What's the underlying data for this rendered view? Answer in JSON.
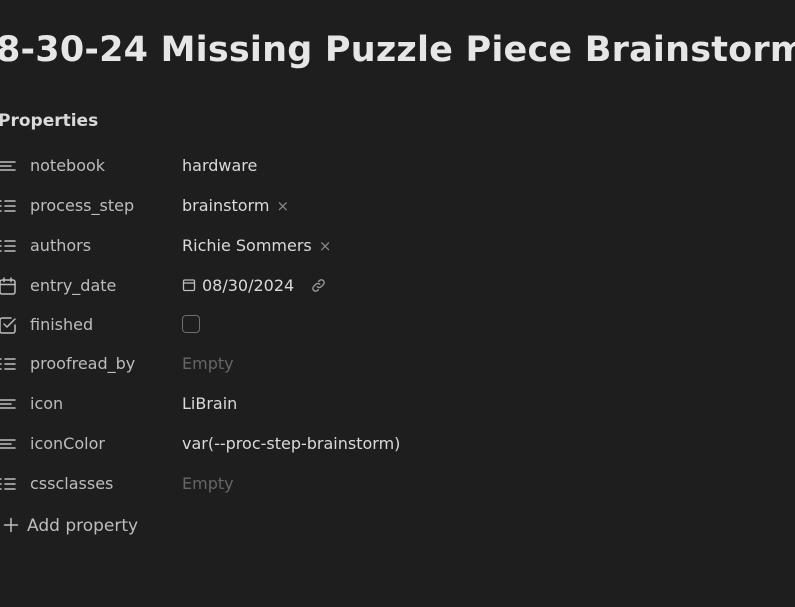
{
  "title": "8-30-24 Missing Puzzle Piece Brainstorm",
  "properties_heading": "Properties",
  "properties": [
    {
      "key": "notebook",
      "icon": "text-lines-icon",
      "value": "hardware"
    },
    {
      "key": "process_step",
      "icon": "list-icon",
      "value": "brainstorm",
      "removable": true
    },
    {
      "key": "authors",
      "icon": "list-icon",
      "value": "Richie Sommers",
      "removable": true
    },
    {
      "key": "entry_date",
      "icon": "calendar-icon",
      "value": "08/30/2024"
    },
    {
      "key": "finished",
      "icon": "checkbox-icon",
      "checked": false
    },
    {
      "key": "proofread_by",
      "icon": "list-icon",
      "value": "Empty",
      "empty": true
    },
    {
      "key": "icon",
      "icon": "text-lines-icon",
      "value": "LiBrain"
    },
    {
      "key": "iconColor",
      "icon": "text-lines-icon",
      "value": "var(--proc-step-brainstorm)"
    },
    {
      "key": "cssclasses",
      "icon": "list-icon",
      "value": "Empty",
      "empty": true
    }
  ],
  "remove_glyph": "×",
  "add_property_label": "Add property",
  "colors": {
    "background": "#1e1e1e",
    "text": "#dadada",
    "muted": "#bdbdbd",
    "placeholder": "#666666"
  }
}
